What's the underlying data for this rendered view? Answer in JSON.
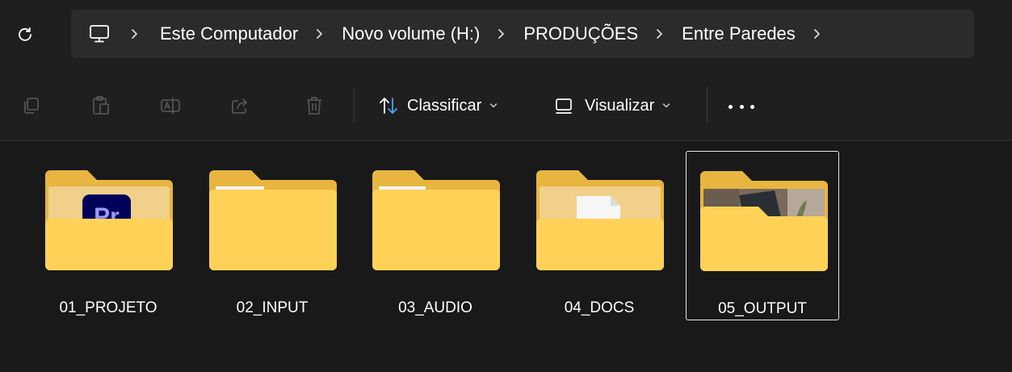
{
  "breadcrumb": {
    "items": [
      "Este Computador",
      "Novo volume (H:)",
      "PRODUÇÕES",
      "Entre Paredes"
    ]
  },
  "toolbar": {
    "sort_label": "Classificar",
    "view_label": "Visualizar"
  },
  "folders": [
    {
      "name": "01_PROJETO"
    },
    {
      "name": "02_INPUT"
    },
    {
      "name": "03_AUDIO"
    },
    {
      "name": "04_DOCS"
    },
    {
      "name": "05_OUTPUT"
    }
  ],
  "premiere_badge": "Pr",
  "icons": {
    "refresh": "refresh-icon",
    "computer": "computer-icon",
    "copy": "copy-icon",
    "paste": "paste-icon",
    "rename": "rename-icon",
    "share": "share-icon",
    "delete": "delete-icon",
    "sort": "sort-icon",
    "view": "view-icon",
    "more": "more-icon"
  },
  "colors": {
    "background": "#191919",
    "bar": "#1f1f1f",
    "crumbs_bg": "#2b2b2b",
    "folder_back": "#e8b540",
    "folder_front": "#ffd257",
    "premiere": "#00005b",
    "premiere_text": "#9999ff",
    "disabled_icon": "#5b5b5b"
  }
}
